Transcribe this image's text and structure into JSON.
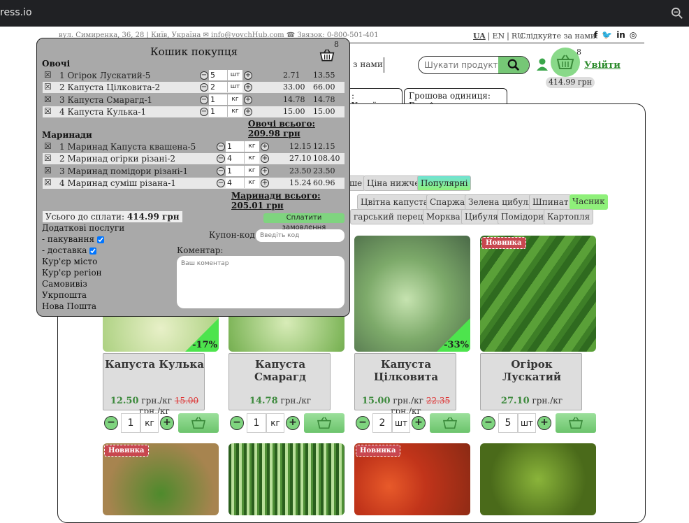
{
  "browser": {
    "url": "ress.io"
  },
  "topbar": {
    "address": "вул. Симиренка, 36, 28 | Київ, Україна  ✉ info@vovchHub.com  ☎ Звязок: 0-800-501-401",
    "langs": [
      "UA",
      "EN",
      "RU"
    ],
    "follow_label": "Слідкуйте за нами:",
    "social": [
      "f",
      "t",
      "in",
      "ig"
    ]
  },
  "header": {
    "nav_text": "з нами",
    "search_placeholder": "Шукати продукт..",
    "cart_count": "8",
    "login": "Увійти",
    "total": "414.99 грн"
  },
  "tabs": {
    "lang": ": Українська",
    "currency": "Грошова одиниця: Грн"
  },
  "filters": {
    "sort": [
      "ше",
      "Ціна нижче",
      "Популярні"
    ],
    "row1": [
      "Цвітна капуста",
      "Спаржа",
      "Зелена цибуля",
      "Шпинат",
      "Часник"
    ],
    "row2": [
      "гарський перець",
      "Морква",
      "Цибуля",
      "Помідори",
      "Картопля"
    ]
  },
  "products": [
    {
      "name": "Капуста Кулька",
      "price": "12.50",
      "unit_label": "грн./кг",
      "old": "15.00",
      "old_unit": "грн./кг",
      "discount": "-17%",
      "qty": "1",
      "unit": "кг",
      "color": "#b8d88a"
    },
    {
      "name": "Капуста Смарагд",
      "price": "14.78",
      "unit_label": "грн./кг",
      "old": "",
      "old_unit": "",
      "discount": "",
      "qty": "1",
      "unit": "кг",
      "color": "#8cc06a"
    },
    {
      "name": "Капуста Цілковита",
      "price": "15.00",
      "unit_label": "грн./кг",
      "old": "22.35",
      "old_unit": "грн./кг",
      "discount": "-33%",
      "qty": "2",
      "unit": "шт",
      "color": "#7ea86a"
    },
    {
      "name": "Огірок Лускатий",
      "price": "27.10",
      "unit_label": "грн./кг",
      "old": "",
      "old_unit": "",
      "discount": "",
      "qty": "5",
      "unit": "шт",
      "badge": "Новинка",
      "color": "#3a7a25"
    }
  ],
  "bottom_badges": [
    "Новинка",
    "Новинка"
  ],
  "cart": {
    "title": "Кошик покупця",
    "count": "8",
    "groups": [
      {
        "name": "Овочі",
        "items": [
          {
            "name": "1 Огірок Лускатий-5",
            "qty": "5",
            "unit": "шт",
            "price": "2.71",
            "sum": "13.55"
          },
          {
            "name": "2 Капуста Цілковита-2",
            "qty": "2",
            "unit": "шт",
            "price": "33.00",
            "sum": "66.00"
          },
          {
            "name": "3 Капуста Смарагд-1",
            "qty": "1",
            "unit": "кг",
            "price": "14.78",
            "sum": "14.78"
          },
          {
            "name": "4 Капуста Кулька-1",
            "qty": "1",
            "unit": "кг",
            "price": "15.00",
            "sum": "15.00"
          }
        ],
        "total": "Овочі всього: 209.98 грн"
      },
      {
        "name": "Маринади",
        "items": [
          {
            "name": "1 Маринад Капуста квашена-5",
            "qty": "1",
            "unit": "кг",
            "price": "12.15",
            "sum": "12.15"
          },
          {
            "name": "2 Маринад огірки різані-2",
            "qty": "4",
            "unit": "кг",
            "price": "27.10",
            "sum": "108.40"
          },
          {
            "name": "3 Маринад помідори різані-1",
            "qty": "1",
            "unit": "кг",
            "price": "23.50",
            "sum": "23.50"
          },
          {
            "name": "4 Маринад суміш різана-1",
            "qty": "4",
            "unit": "кг",
            "price": "15.24",
            "sum": "60.96"
          }
        ],
        "total": "Маринади всього: 205.01 грн"
      }
    ],
    "pay_label": "Усього до сплати:",
    "pay_total": "414.99 грн",
    "pay_button": "Сплатити замовлення",
    "services_title": "Додаткові послуги",
    "packaging": "- пакування",
    "delivery": "- доставка",
    "delivery_options": [
      "Кур'єр місто",
      "Кур'єр регіон",
      "Самовивіз",
      "Укрпошта",
      "Нова Пошта"
    ],
    "coupon_label": "Купон-код:",
    "coupon_placeholder": "Введіть код",
    "comment_label": "Коментар:",
    "comment_placeholder": "Ваш коментар"
  }
}
